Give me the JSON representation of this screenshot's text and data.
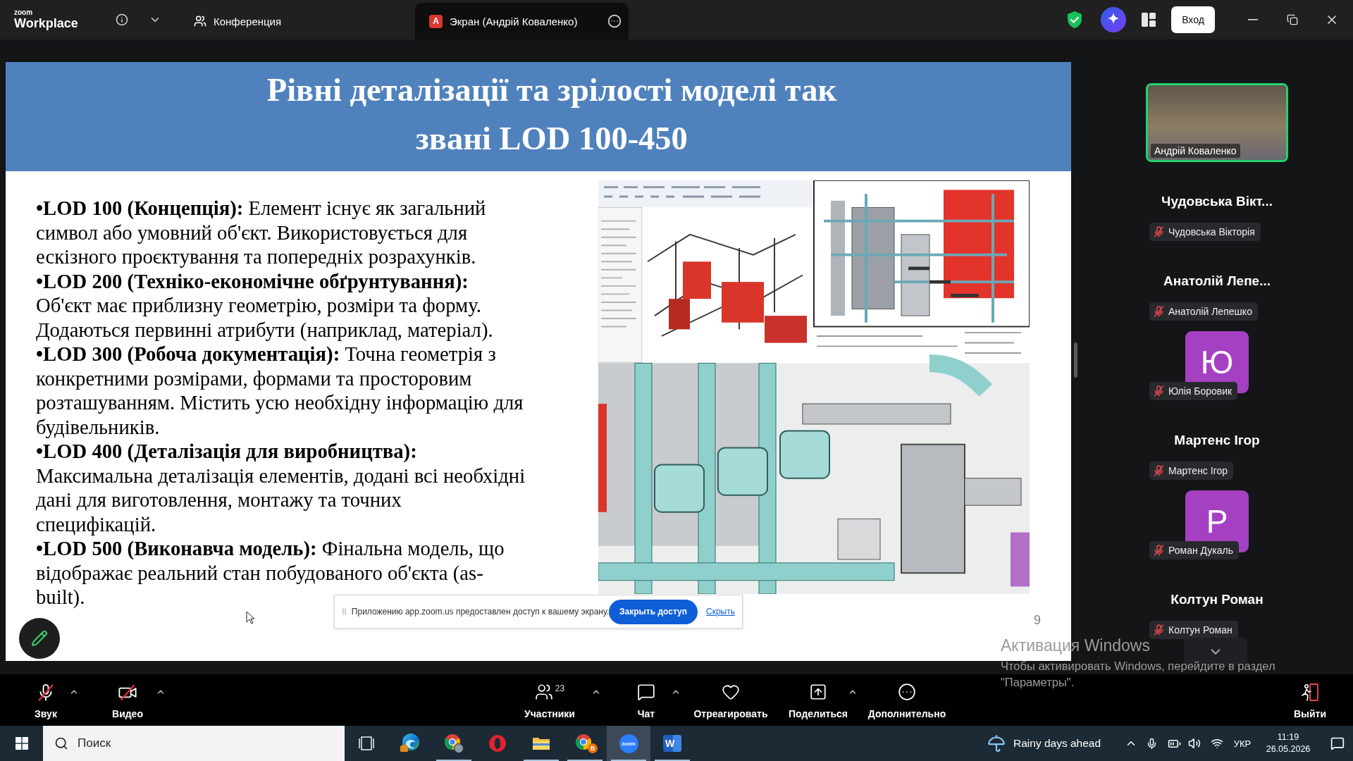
{
  "title_bar": {
    "logo_small": "zoom",
    "logo": "Workplace",
    "tabs": [
      {
        "kind": "meeting",
        "label": "Конференция",
        "selected": false
      },
      {
        "kind": "screen",
        "badge": "А",
        "label": "Экран (Андрій Коваленко)",
        "selected": true
      }
    ],
    "sign_in": "Вход"
  },
  "slide": {
    "title": "Рівні деталізації та зрілості моделі так звані LOD 100-450",
    "paragraphs": [
      "**•LOD 100 (Концепція):** Елемент існує як загальний\nсимвол або умовний об'єкт. Використовується для\nескізного проєктування та попередніх розрахунків.",
      "**•LOD 200 (Техніко-економічне обґрунтування):**\nОб'єкт має приблизну геометрію, розміри та форму.\nДодаються первинні атрибути (наприклад, матеріал).",
      "**•LOD 300 (Робоча документація):** Точна геометрія з\nконкретними розмірами, формами та просторовим\nрозташуванням. Містить усю необхідну інформацію для\nбудівельників.",
      "**•LOD 400 (Деталізація для виробництва):**\nМаксимальна деталізація елементів, додані всі необхідні\nдані для виготовлення, монтажу та точних\nспецифікацій.",
      "**•LOD 500 (Виконавча модель):** Фінальна модель, що\nвідображає реальний стан побудованого об'єкта (as-\nbuilt)."
    ],
    "page_number": "9"
  },
  "share_notice": {
    "message": "Приложению app.zoom.us предоставлен доступ к вашему экрану.",
    "stop_button": "Закрыть доступ",
    "hide_link": "Скрыть"
  },
  "participants": [
    {
      "kind": "video",
      "name": "Андрій Коваленко",
      "muted": false,
      "speaking": true
    },
    {
      "kind": "name",
      "title": "Чудовська Вікт...",
      "name": "Чудовська Вікторія",
      "muted": true
    },
    {
      "kind": "name",
      "title": "Анатолій Лепе...",
      "name": "Анатолій Лепешко",
      "muted": true
    },
    {
      "kind": "avatar",
      "initial": "Ю",
      "name": "Юлія Боровик",
      "muted": true
    },
    {
      "kind": "name",
      "title": "Мартенс Ігор",
      "name": "Мартенс Ігор",
      "muted": true
    },
    {
      "kind": "avatar",
      "initial": "Р",
      "name": "Роман Дукаль",
      "muted": true
    },
    {
      "kind": "name",
      "title": "Колтун Роман",
      "name": "Колтун Роман",
      "muted": true
    }
  ],
  "toolbar": [
    {
      "kind": "audio",
      "label": "Звук",
      "off": true,
      "menu": true
    },
    {
      "kind": "video",
      "label": "Видео",
      "off": true,
      "menu": true
    },
    {
      "kind": "participants",
      "label": "Участники",
      "count": "23",
      "menu": true
    },
    {
      "kind": "chat",
      "label": "Чат",
      "menu": true
    },
    {
      "kind": "react",
      "label": "Отреагировать",
      "menu": false
    },
    {
      "kind": "share",
      "label": "Поделиться",
      "menu": true
    },
    {
      "kind": "more",
      "label": "Дополнительно",
      "menu": false
    },
    {
      "kind": "leave",
      "label": "Выйти",
      "menu": false
    }
  ],
  "activation_notice": {
    "title": "Активация Windows",
    "message": "Чтобы активировать Windows, перейдите в раздел \"Параметры\"."
  },
  "taskbar": {
    "search_placeholder": "Поиск",
    "apps": [
      {
        "kind": "task-view",
        "running": false,
        "selected": false
      },
      {
        "kind": "edge",
        "running": false,
        "selected": false
      },
      {
        "kind": "chrome",
        "running": true,
        "selected": false
      },
      {
        "kind": "opera",
        "running": false,
        "selected": false
      },
      {
        "kind": "explorer",
        "running": true,
        "selected": false
      },
      {
        "kind": "chrome",
        "badge": "B",
        "running": true,
        "selected": false
      },
      {
        "kind": "zoom",
        "logo_text": "zoom",
        "running": true,
        "selected": true
      },
      {
        "kind": "word",
        "letter": "W",
        "running": true,
        "selected": false
      }
    ],
    "weather": "Rainy days ahead",
    "language": "УКР",
    "time": "11:19",
    "date": "26.05.2026"
  }
}
